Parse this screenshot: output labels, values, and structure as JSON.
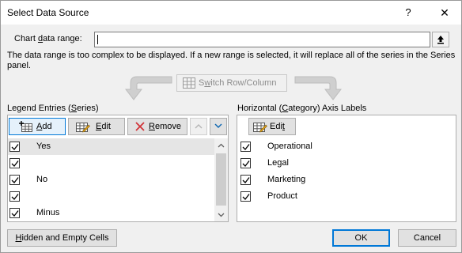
{
  "dialog": {
    "title": "Select Data Source",
    "help_glyph": "?",
    "close_glyph": "✕"
  },
  "range": {
    "label_pre": "Chart ",
    "label_ul": "d",
    "label_post": "ata range:",
    "value": ""
  },
  "message": "The data range is too complex to be displayed. If a new range is selected, it will replace all of the series in the Series panel.",
  "switch": {
    "label_pre": "S",
    "label_ul": "w",
    "label_post": "itch Row/Column",
    "enabled": false
  },
  "legend": {
    "label_pre": "Legend Entries (",
    "label_ul": "S",
    "label_post": "eries)",
    "add": {
      "ul": "A",
      "rest": "dd"
    },
    "edit": {
      "ul": "E",
      "rest": "dit"
    },
    "remove": {
      "ul": "R",
      "rest": "emove"
    },
    "items": [
      {
        "label": "Yes",
        "checked": true
      },
      {
        "label": "",
        "checked": true
      },
      {
        "label": "No",
        "checked": true
      },
      {
        "label": "",
        "checked": true
      },
      {
        "label": "Minus",
        "checked": true
      }
    ]
  },
  "axis": {
    "label_pre": "Horizontal (",
    "label_ul": "C",
    "label_post": "ategory) Axis Labels",
    "edit": {
      "pre": "Edi",
      "ul": "t",
      "rest": ""
    },
    "items": [
      {
        "label": "Operational",
        "checked": true
      },
      {
        "label": "Legal",
        "checked": true
      },
      {
        "label": "Marketing",
        "checked": true
      },
      {
        "label": "Product",
        "checked": true
      }
    ]
  },
  "footer": {
    "hidden_pre": "",
    "hidden_ul": "H",
    "hidden_post": "idden and Empty Cells",
    "ok": "OK",
    "cancel": "Cancel"
  },
  "colors": {
    "accent": "#0078d7",
    "selection": "#cde8ff",
    "remove_red": "#d13438"
  }
}
